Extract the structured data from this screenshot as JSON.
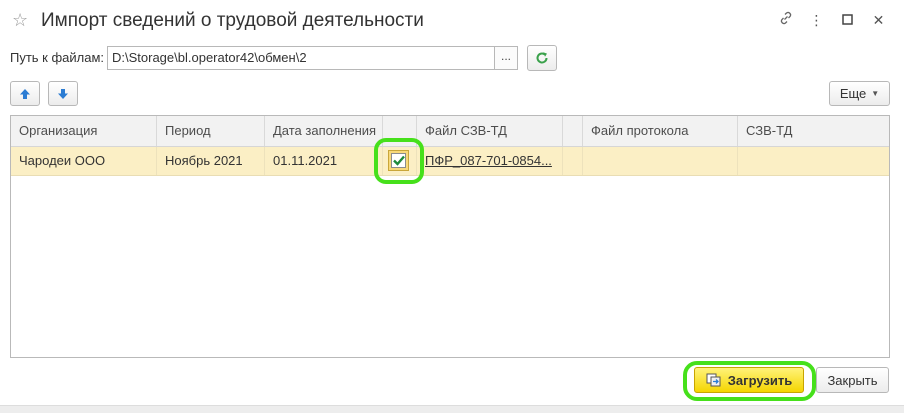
{
  "window": {
    "title": "Импорт сведений о трудовой деятельности",
    "star_icon": "star-icon",
    "controls": [
      "link-icon",
      "more-vertical-icon",
      "maximize-icon",
      "close-icon"
    ],
    "control_glyphs": [
      "🔗",
      "⋮",
      "☐",
      "✕"
    ]
  },
  "path": {
    "label": "Путь к файлам:",
    "value": "D:\\Storage\\bl.operator42\\обмен\\2",
    "browse_label": "...",
    "refresh_icon": "refresh-icon"
  },
  "toolbar": {
    "up_icon": "arrow-up-icon",
    "down_icon": "arrow-down-icon",
    "more_label": "Еще",
    "more_caret": "▼"
  },
  "table": {
    "columns": [
      "Организация",
      "Период",
      "Дата заполнения",
      "",
      "Файл СЗВ-ТД",
      "",
      "Файл протокола",
      "СЗВ-ТД",
      ""
    ],
    "rows": [
      {
        "organization": "Чародеи ООО",
        "period": "Ноябрь 2021",
        "date": "01.11.2021",
        "checked": true,
        "file": "ПФР_087-701-0854...",
        "protocol": "",
        "szv_td": ""
      }
    ]
  },
  "footer": {
    "load_label": "Загрузить",
    "close_label": "Закрыть"
  },
  "colors": {
    "accent_highlight": "#46e01b",
    "selected_row": "#fbefc5",
    "primary_button": "#f5d500",
    "arrow_blue": "#2b7cd3",
    "refresh_green": "#3aa14b"
  }
}
